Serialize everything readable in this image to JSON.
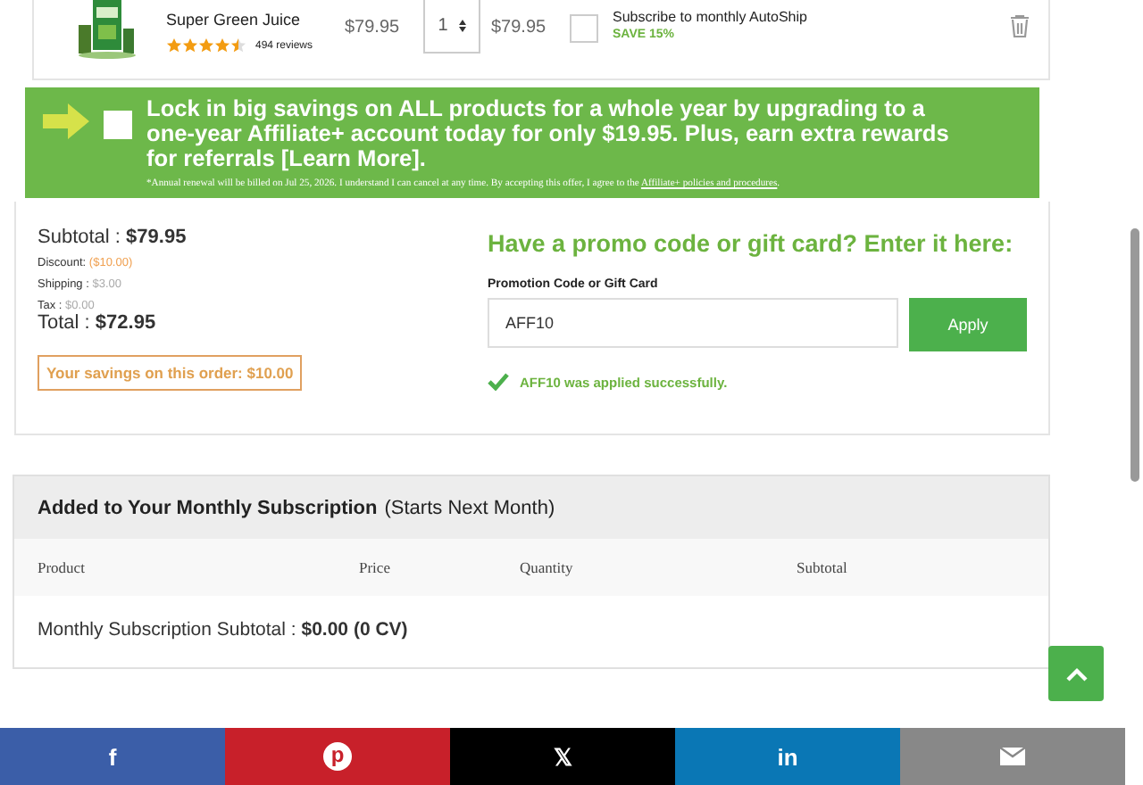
{
  "cart_item": {
    "kind": "picture",
    "name": "Super Green Juice",
    "stars": 4.5,
    "reviews": "494 reviews",
    "price": "$79.95",
    "quantity": "1",
    "total": "$79.95",
    "autoship": {
      "checked": false,
      "label": "Subscribe to monthly AutoShip",
      "badge": "SAVE 15%"
    }
  },
  "upgrade_offer": {
    "checked": false,
    "text": "Lock in big savings on ALL products for a whole year by upgrading to a one-year Affiliate+ account today for only $19.95. Plus, earn extra rewards for referrals [Learn More].",
    "note": "*Annual renewal will be billed on Jul 25, 2026. I understand I can cancel at any time. By accepting this offer, I agree to the",
    "link": "Affiliate+ policies and procedures",
    "note_end": "."
  },
  "totals": {
    "subtotal_label": "Subtotal :",
    "subtotal": "$79.95",
    "discount_label": "Discount:",
    "discount": "($10.00)",
    "shipping_label": "Shipping :",
    "shipping": "$3.00",
    "tax_label": "Tax :",
    "tax": "$0.00",
    "total_label": "Total :",
    "total": "$72.95",
    "savings": "Your savings on this order: $10.00"
  },
  "promo": {
    "heading": "Have a promo code or gift card? Enter it here:",
    "field_label": "Promotion Code or Gift Card",
    "value": "AFF10",
    "button": "Apply",
    "message": "AFF10 was applied successfully."
  },
  "subscription": {
    "title": "Added to Your Monthly Subscription",
    "title_note": "(Starts Next Month)",
    "columns": [
      "Product",
      "Price",
      "Quantity",
      "Subtotal"
    ],
    "subtotal_label": "Monthly Subscription Subtotal :",
    "subtotal": "$0.00 (0 CV)"
  },
  "share_bar": [
    {
      "kind": "facebook",
      "glyph": "f"
    },
    {
      "kind": "pinterest",
      "glyph": "p"
    },
    {
      "kind": "x",
      "glyph": "𝕏"
    },
    {
      "kind": "linkedin",
      "glyph": "in"
    },
    {
      "kind": "email"
    }
  ]
}
